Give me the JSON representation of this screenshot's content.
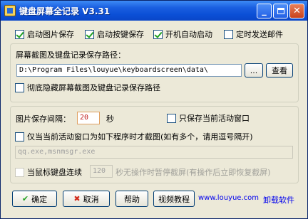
{
  "window": {
    "title": "键盘屏幕全记录 V3.31"
  },
  "options": {
    "start_image_save": "启动图片保存",
    "start_key_save": "启动按键保存",
    "auto_start": "开机自动启动",
    "timed_email": "定时发送邮件"
  },
  "path_group": {
    "label": "屏幕截图及键盘记录保存路径：",
    "path_value": "D:\\Program Files\\louyue\\keyboardscreen\\data\\",
    "browse_label": "...",
    "view_label": "查看",
    "hide_path": "彻底隐藏屏幕截图及键盘记录保存路径"
  },
  "capture_group": {
    "interval_label": "图片保存间隔：",
    "interval_value": "20",
    "interval_unit": "秒",
    "only_active_window": "只保存当前活动窗口",
    "only_specific_program": "仅当当前活动窗口为如下程序时才截图(如有多个，请用逗号隔开)",
    "program_list": "qq.exe,msnmsgr.exe",
    "pause_idle_prefix": "当鼠标键盘连续",
    "pause_idle_value": "120",
    "pause_idle_suffix": "秒无操作时暂停截屏(有操作后立即恢复截屏)"
  },
  "footer": {
    "ok": "确定",
    "cancel": "取消",
    "help": "帮助",
    "video": "视频教程",
    "site_link": "www.louyue.com",
    "uninstall_link": "卸载软件"
  }
}
